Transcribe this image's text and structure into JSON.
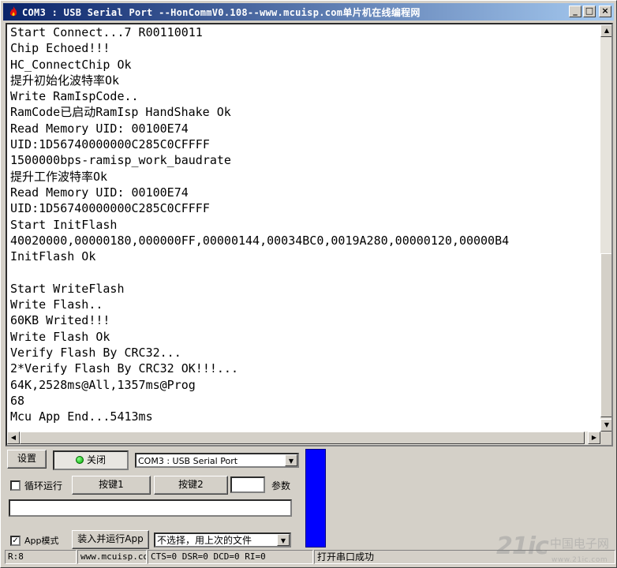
{
  "window": {
    "title": "COM3 : USB Serial Port   --HonCommV0.108--www.mcuisp.com单片机在线编程网",
    "min_label": "_",
    "max_label": "□",
    "close_label": "×"
  },
  "console": {
    "lines": [
      "Start Connect...7 R00110011",
      "Chip Echoed!!!",
      "HC_ConnectChip Ok",
      "提升初始化波特率Ok",
      "Write RamIspCode..",
      "RamCode已启动RamIsp HandShake Ok",
      "Read Memory UID: 00100E74",
      "UID:1D56740000000C285C0CFFFF",
      "1500000bps-ramisp_work_baudrate",
      "提升工作波特率Ok",
      "Read Memory UID: 00100E74",
      "UID:1D56740000000C285C0CFFFF",
      "Start InitFlash",
      "40020000,00000180,000000FF,00000144,00034BC0,0019A280,00000120,00000B4",
      "InitFlash Ok",
      "",
      "Start WriteFlash",
      "Write Flash..",
      "60KB Writed!!!",
      "Write Flash Ok",
      "Verify Flash By CRC32...",
      "2*Verify Flash By CRC32 OK!!!...",
      "64K,2528ms@All,1357ms@Prog",
      "68",
      "Mcu App End...5413ms"
    ]
  },
  "controls": {
    "settings_label": "设置",
    "close_port_label": "关闭",
    "port_select_value": "COM3 : USB Serial Port",
    "loop_run_label": "循环运行",
    "loop_run_checked": false,
    "key1_label": "按键1",
    "key2_label": "按键2",
    "param_value": "",
    "param_label": "参数",
    "send_value": "",
    "app_mode_label": "App模式",
    "app_mode_checked": true,
    "load_run_label": "装入并运行App",
    "file_select_value": "不选择，用上次的文件"
  },
  "statusbar": {
    "r_value": "R:8",
    "url": "www.mcuisp.com",
    "signals": "CTS=0 DSR=0 DCD=0 RI=0",
    "status": "打开串口成功"
  },
  "watermark": {
    "brand": "21ic",
    "cn": "中国电子网",
    "url": "www.21ic.com"
  },
  "colors": {
    "titlebar_start": "#0a246a",
    "titlebar_end": "#a6caf0",
    "indicator_bar": "#0000ff",
    "led": "#00aa00"
  },
  "icons": {
    "app": "red-flame-icon",
    "scroll_up": "arrow-up-icon",
    "scroll_down": "arrow-down-icon",
    "scroll_left": "arrow-left-icon",
    "scroll_right": "arrow-right-icon",
    "dropdown": "chevron-down-icon",
    "checkbox": "checkmark-icon"
  }
}
